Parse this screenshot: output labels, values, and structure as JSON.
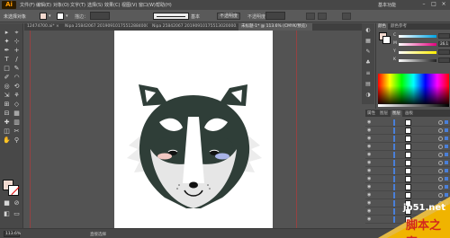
{
  "app": {
    "logo": "Ai",
    "workspace": "基本功能"
  },
  "menu": [
    "文件(F)",
    "编辑(E)",
    "对象(O)",
    "文字(T)",
    "选择(S)",
    "效果(C)",
    "视图(V)",
    "窗口(W)",
    "帮助(H)"
  ],
  "window_buttons": [
    "–",
    "□",
    "×"
  ],
  "control_bar": {
    "selection_label": "未选择对象",
    "stroke_label": "描边：",
    "stroke_weight": "",
    "profile_label": "基本",
    "style_label": "不透明度",
    "opacity_label": "不透明度",
    "opacity_value": "",
    "fill_color": "#f2d9cf"
  },
  "tabs": [
    {
      "label": "12474700.ai* ×",
      "active": false
    },
    {
      "label": "Nipa 25842067 20190910175512884000.ai* ×",
      "active": false
    },
    {
      "label": "Nipa 25842067 20190910175513020000.ai* ×",
      "active": false
    },
    {
      "label": "未标题-1* @ 113.6% (CMYK/预览)",
      "active": true
    }
  ],
  "tools": [
    "▸",
    "⌖",
    "✦",
    "⊹",
    "✒",
    "+",
    "T",
    "/",
    "□",
    "✎",
    "✐",
    "◠",
    "◎",
    "⟲",
    "⇲",
    "⚘",
    "⊞",
    "◇",
    "⊟",
    "▦",
    "✚",
    "▥",
    "◫",
    "✂",
    "✋",
    "⚲"
  ],
  "color_panel": {
    "tabs": [
      "颜色",
      "颜色参考"
    ],
    "fill": "#f2d9cf",
    "sliders": [
      {
        "label": "C",
        "value": "",
        "unit": "%",
        "color": "#00a4e4"
      },
      {
        "label": "M",
        "value": "26.1",
        "unit": "%",
        "color": "#e4007f"
      },
      {
        "label": "Y",
        "value": "",
        "unit": "%",
        "color": "#ffed00"
      },
      {
        "label": "K",
        "value": "",
        "unit": "%",
        "color": "#222222"
      }
    ]
  },
  "layers_panel": {
    "tabs": [
      "属性",
      "图层",
      "图层",
      "画板"
    ],
    "rows": [
      "",
      "",
      "",
      "",
      "",
      "",
      "",
      "",
      "",
      "",
      "",
      "",
      ""
    ]
  },
  "status": {
    "zoom": "113.6%",
    "text": "直接选择"
  },
  "watermark": {
    "site": "jb51.net",
    "name": "脚本之家"
  }
}
